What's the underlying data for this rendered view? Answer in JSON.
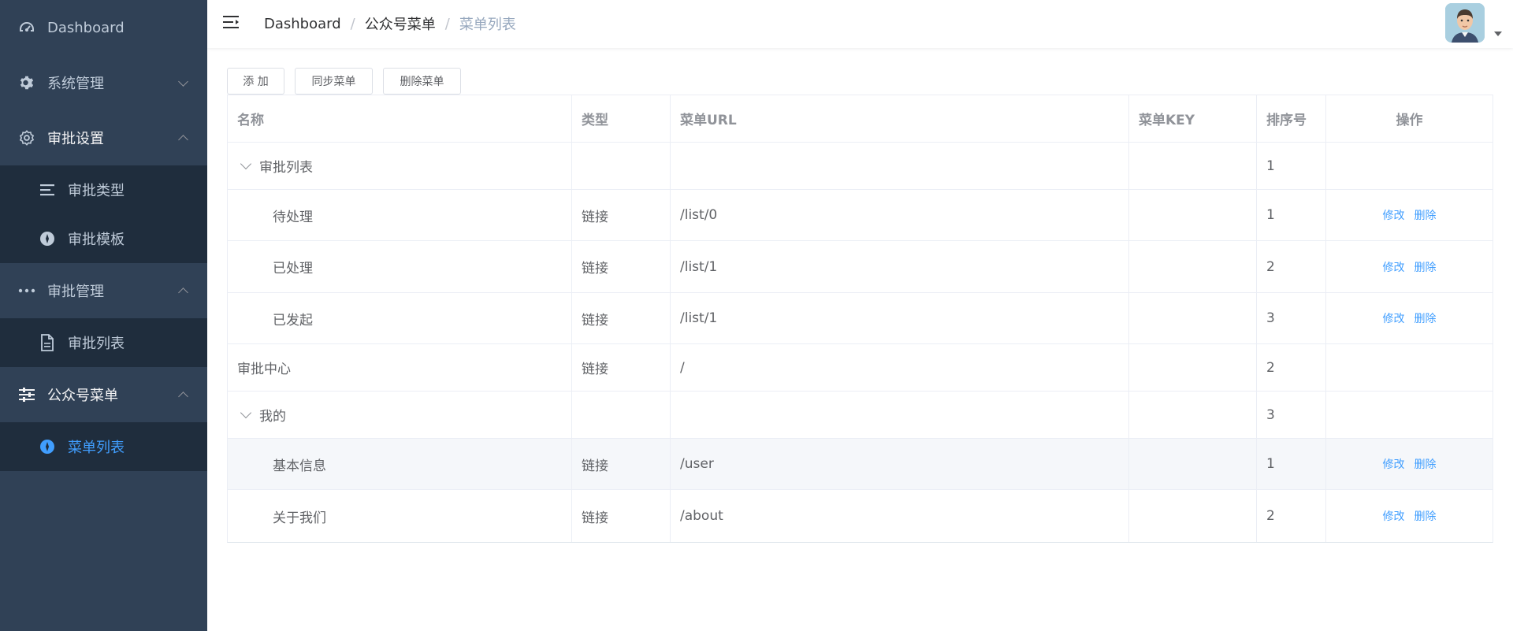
{
  "sidebar": {
    "items": [
      {
        "label": "Dashboard",
        "icon": "dashboard-icon"
      },
      {
        "label": "系统管理",
        "icon": "gear-icon"
      },
      {
        "label": "审批设置",
        "icon": "settings-icon"
      },
      {
        "label": "审批类型",
        "icon": "list-icon"
      },
      {
        "label": "审批模板",
        "icon": "compass-icon"
      },
      {
        "label": "审批管理",
        "icon": "more-icon"
      },
      {
        "label": "审批列表",
        "icon": "document-icon"
      },
      {
        "label": "公众号菜单",
        "icon": "sliders-icon"
      },
      {
        "label": "菜单列表",
        "icon": "compass-icon"
      }
    ]
  },
  "header": {
    "breadcrumb": [
      "Dashboard",
      "公众号菜单",
      "菜单列表"
    ],
    "separator": "/"
  },
  "toolbar": {
    "add_label": "添 加",
    "sync_label": "同步菜单",
    "delete_label": "删除菜单"
  },
  "table": {
    "columns": [
      "名称",
      "类型",
      "菜单URL",
      "菜单KEY",
      "排序号",
      "操作"
    ],
    "edit_label": "修改",
    "delete_label": "删除",
    "rows": [
      {
        "name": "审批列表",
        "type": "",
        "url": "",
        "key": "",
        "sort": "1"
      },
      {
        "name": "待处理",
        "type": "链接",
        "url": "/list/0",
        "key": "",
        "sort": "1"
      },
      {
        "name": "已处理",
        "type": "链接",
        "url": "/list/1",
        "key": "",
        "sort": "2"
      },
      {
        "name": "已发起",
        "type": "链接",
        "url": "/list/1",
        "key": "",
        "sort": "3"
      },
      {
        "name": "审批中心",
        "type": "链接",
        "url": "/",
        "key": "",
        "sort": "2"
      },
      {
        "name": "我的",
        "type": "",
        "url": "",
        "key": "",
        "sort": "3"
      },
      {
        "name": "基本信息",
        "type": "链接",
        "url": "/user",
        "key": "",
        "sort": "1"
      },
      {
        "name": "关于我们",
        "type": "链接",
        "url": "/about",
        "key": "",
        "sort": "2"
      }
    ]
  },
  "colors": {
    "sidebar_bg": "#304156",
    "submenu_bg": "#1f2d3d",
    "accent": "#409eff"
  }
}
